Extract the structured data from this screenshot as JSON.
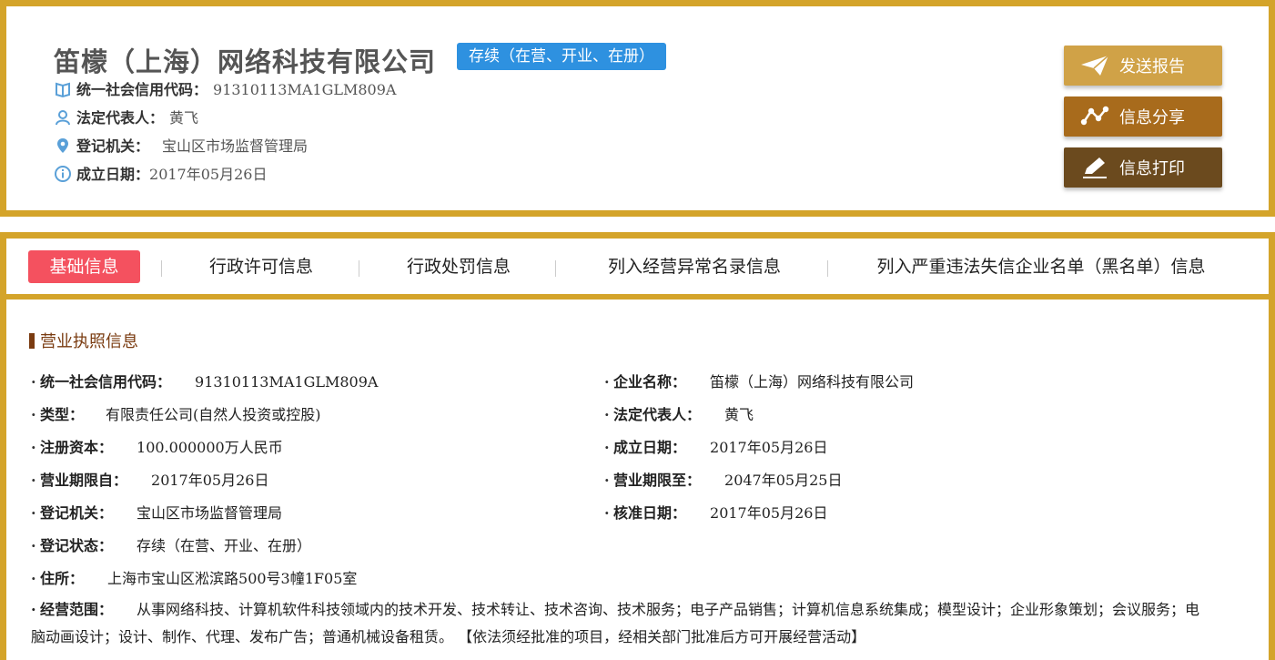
{
  "company": {
    "name": "笛檬（上海）网络科技有限公司",
    "status": "存续（在营、开业、在册）",
    "credit_code_label": "统一社会信用代码：",
    "credit_code": "91310113MA1GLM809A",
    "legal_rep_label": "法定代表人：",
    "legal_rep": "黄飞",
    "reg_authority_label": "登记机关：",
    "reg_authority": "宝山区市场监督管理局",
    "founded_label": "成立日期：",
    "founded": "2017年05月26日"
  },
  "actions": {
    "send_report": "发送报告",
    "share_info": "信息分享",
    "print_info": "信息打印"
  },
  "tabs": [
    {
      "label": "基础信息",
      "active": true
    },
    {
      "label": "行政许可信息",
      "active": false
    },
    {
      "label": "行政处罚信息",
      "active": false
    },
    {
      "label": "列入经营异常名录信息",
      "active": false
    },
    {
      "label": "列入严重违法失信企业名单（黑名单）信息",
      "active": false
    }
  ],
  "license": {
    "section_title": "营业执照信息",
    "fields": [
      {
        "key": "统一社会信用代码：",
        "value": "91310113MA1GLM809A"
      },
      {
        "key": "企业名称：",
        "value": "笛檬（上海）网络科技有限公司"
      },
      {
        "key": "类型：",
        "value": "有限责任公司(自然人投资或控股)"
      },
      {
        "key": "法定代表人：",
        "value": "黄飞"
      },
      {
        "key": "注册资本：",
        "value": "100.000000万人民币"
      },
      {
        "key": "成立日期：",
        "value": "2017年05月26日"
      },
      {
        "key": "营业期限自：",
        "value": "2017年05月26日"
      },
      {
        "key": "营业期限至：",
        "value": "2047年05月25日"
      },
      {
        "key": "登记机关：",
        "value": "宝山区市场监督管理局"
      },
      {
        "key": "核准日期：",
        "value": "2017年05月26日"
      },
      {
        "key": "登记状态：",
        "value": "存续（在营、开业、在册）"
      },
      {
        "key": "住所：",
        "value": "上海市宝山区淞滨路500号3幢1F05室"
      }
    ],
    "scope_key": "经营范围：",
    "scope_value": "从事网络科技、计算机软件科技领域内的技术开发、技术转让、技术咨询、技术服务；电子产品销售；计算机信息系统集成；模型设计；企业形象策划；会议服务；电脑动画设计；设计、制作、代理、发布广告；普通机械设备租赁。 【依法须经批准的项目，经相关部门批准后方可开展经营活动】"
  },
  "colors": {
    "frame": "#d4a42a",
    "status_badge": "#2e91e0",
    "active_tab": "#f4515f",
    "btn_send": "#d0a247",
    "btn_share": "#a86b1c",
    "btn_print": "#6b4a1e",
    "section_title": "#7a3b10"
  },
  "icons": [
    "book-icon",
    "person-icon",
    "location-pin-icon",
    "info-icon",
    "paper-plane-icon",
    "share-icon",
    "pencil-icon"
  ]
}
